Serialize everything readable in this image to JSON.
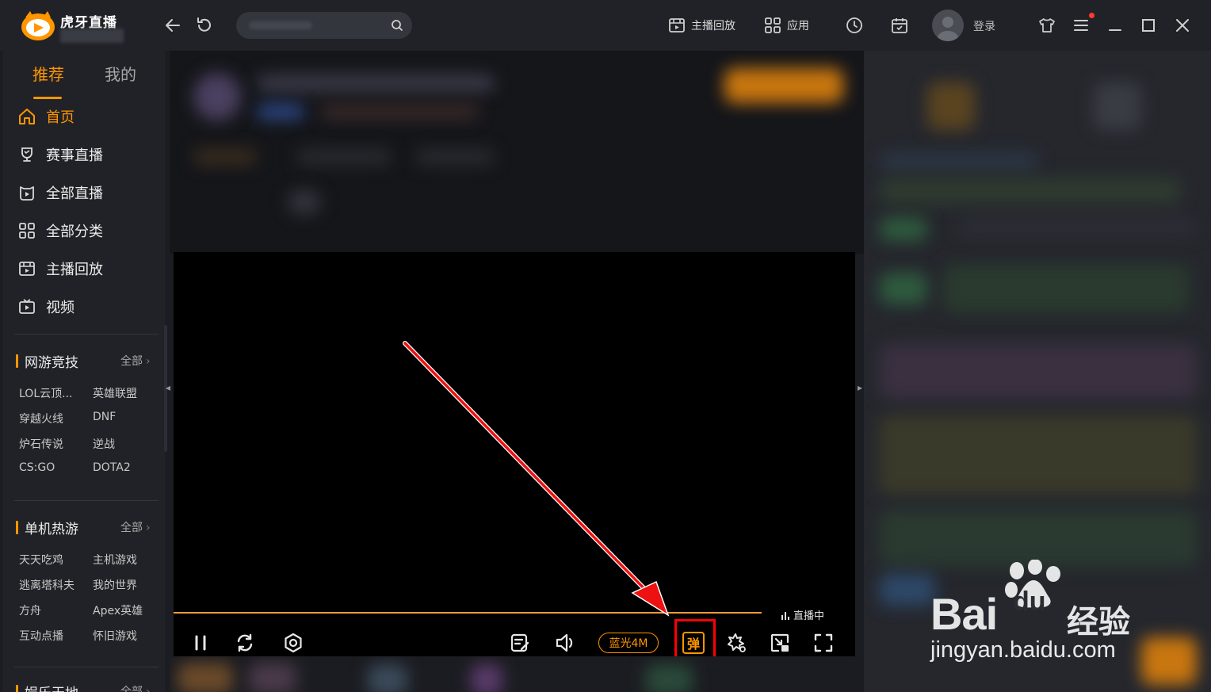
{
  "app": {
    "name": "虎牙直播",
    "accent": "#ff9600"
  },
  "titlebar": {
    "replay_label": "主播回放",
    "apps_label": "应用",
    "login_label": "登录",
    "icons": [
      "back-arrow-icon",
      "refresh-icon",
      "search-icon",
      "replay-icon",
      "apps-grid-icon",
      "history-clock-icon",
      "calendar-icon",
      "avatar-icon",
      "skin-shirt-icon",
      "menu-icon",
      "minimize-icon",
      "maximize-icon",
      "close-icon"
    ]
  },
  "sidebar": {
    "tabs": [
      {
        "label": "推荐",
        "active": true
      },
      {
        "label": "我的",
        "active": false
      }
    ],
    "nav": [
      {
        "label": "首页",
        "icon": "home-icon",
        "active": true
      },
      {
        "label": "赛事直播",
        "icon": "trophy-icon"
      },
      {
        "label": "全部直播",
        "icon": "live-icon"
      },
      {
        "label": "全部分类",
        "icon": "category-grid-icon"
      },
      {
        "label": "主播回放",
        "icon": "replay-icon"
      },
      {
        "label": "视频",
        "icon": "tv-icon"
      }
    ],
    "sections": [
      {
        "title": "网游竞技",
        "all_label": "全部",
        "items": [
          "LOL云顶...",
          "英雄联盟",
          "穿越火线",
          "DNF",
          "炉石传说",
          "逆战",
          "CS:GO",
          "DOTA2"
        ]
      },
      {
        "title": "单机热游",
        "all_label": "全部",
        "items": [
          "天天吃鸡",
          "主机游戏",
          "逃离塔科夫",
          "我的世界",
          "方舟",
          "Apex英雄",
          "互动点播",
          "怀旧游戏"
        ]
      },
      {
        "title": "娱乐天地",
        "all_label": "全部"
      }
    ]
  },
  "player": {
    "live_status": "直播中",
    "quality_label": "蓝光4M",
    "danmu_label": "弹",
    "controls": [
      "pause-icon",
      "refresh-icon",
      "record-icon",
      "danmu-settings-icon",
      "volume-icon",
      "quality-button",
      "danmu-toggle",
      "effects-icon",
      "mini-window-icon",
      "fullscreen-icon"
    ]
  },
  "watermark": {
    "brand_bai": "Bai",
    "brand_du": "du",
    "brand_jingyan": "经验",
    "url": "jingyan.baidu.com"
  }
}
